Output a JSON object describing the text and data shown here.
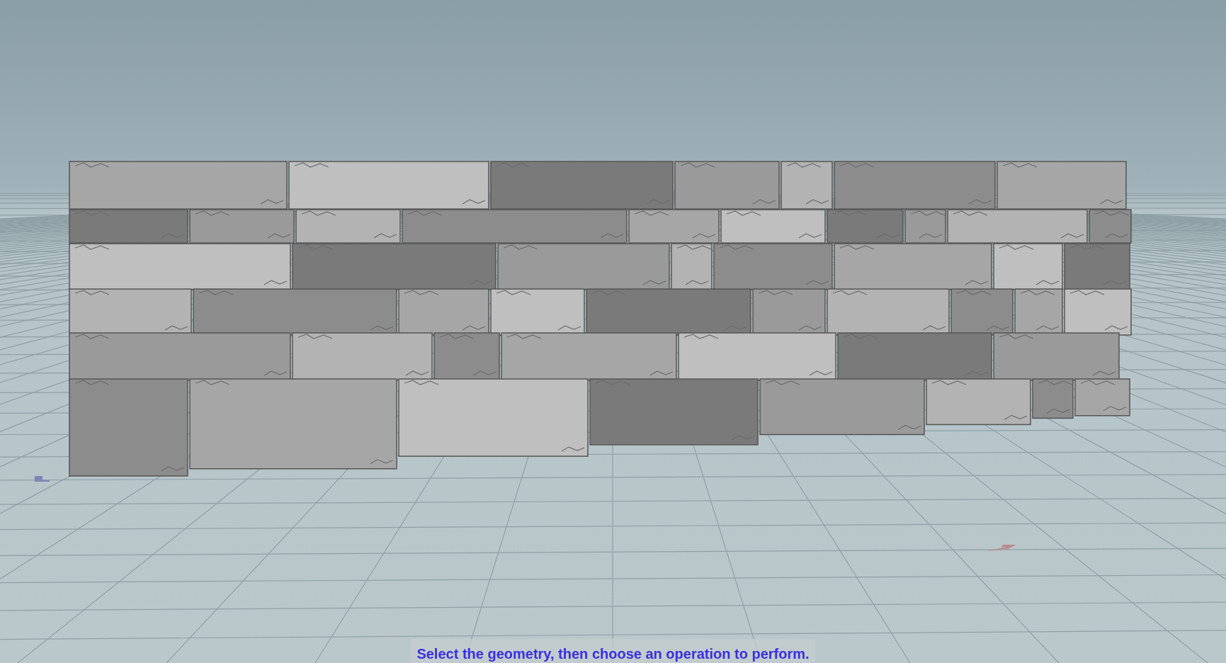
{
  "viewport": {
    "status_message": "Select the geometry, then choose an operation to perform."
  }
}
